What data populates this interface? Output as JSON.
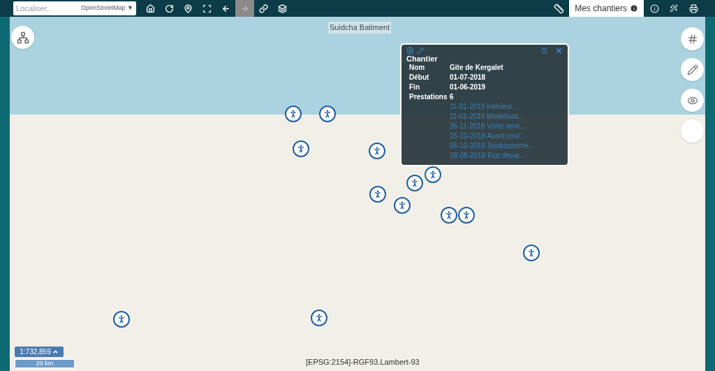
{
  "search": {
    "placeholder": "Localiser...",
    "basemap": "OpenStreetMap",
    "caret": "▼"
  },
  "toolbar": [
    {
      "kind": "home",
      "disabled": false
    },
    {
      "kind": "refresh",
      "disabled": false
    },
    {
      "kind": "pin",
      "disabled": false
    },
    {
      "kind": "xy",
      "disabled": false
    },
    {
      "kind": "back",
      "disabled": false
    },
    {
      "kind": "forward",
      "disabled": true
    },
    {
      "kind": "link",
      "disabled": false
    },
    {
      "kind": "layers",
      "disabled": false
    }
  ],
  "tabs": [
    {
      "label": "Mes chantiers",
      "selected": true
    }
  ],
  "map": {
    "label": "Suidcha Batiment",
    "projection": "[EPSG:2154]-RGF93.Lambert-93"
  },
  "popup": {
    "title": "Chantier",
    "fields": [
      {
        "label": "Nom",
        "value": "Gite de Kergalet"
      },
      {
        "label": "Début",
        "value": "01-07-2018"
      },
      {
        "label": "Fin",
        "value": "01-06-2019"
      },
      {
        "label": "Prestations",
        "value": "6"
      }
    ],
    "prestations": [
      "11-01-2019 Intérieur...",
      "11-01-2019 Modélisati...",
      "26-11-2018 Visite mon...",
      "15-10-2018 Avant coul...",
      "05-10-2018 Soubasseme...",
      "18-08-2018 Etat dépar..."
    ]
  },
  "scale": {
    "ratio": "1:732,859",
    "bar": "20 km"
  }
}
